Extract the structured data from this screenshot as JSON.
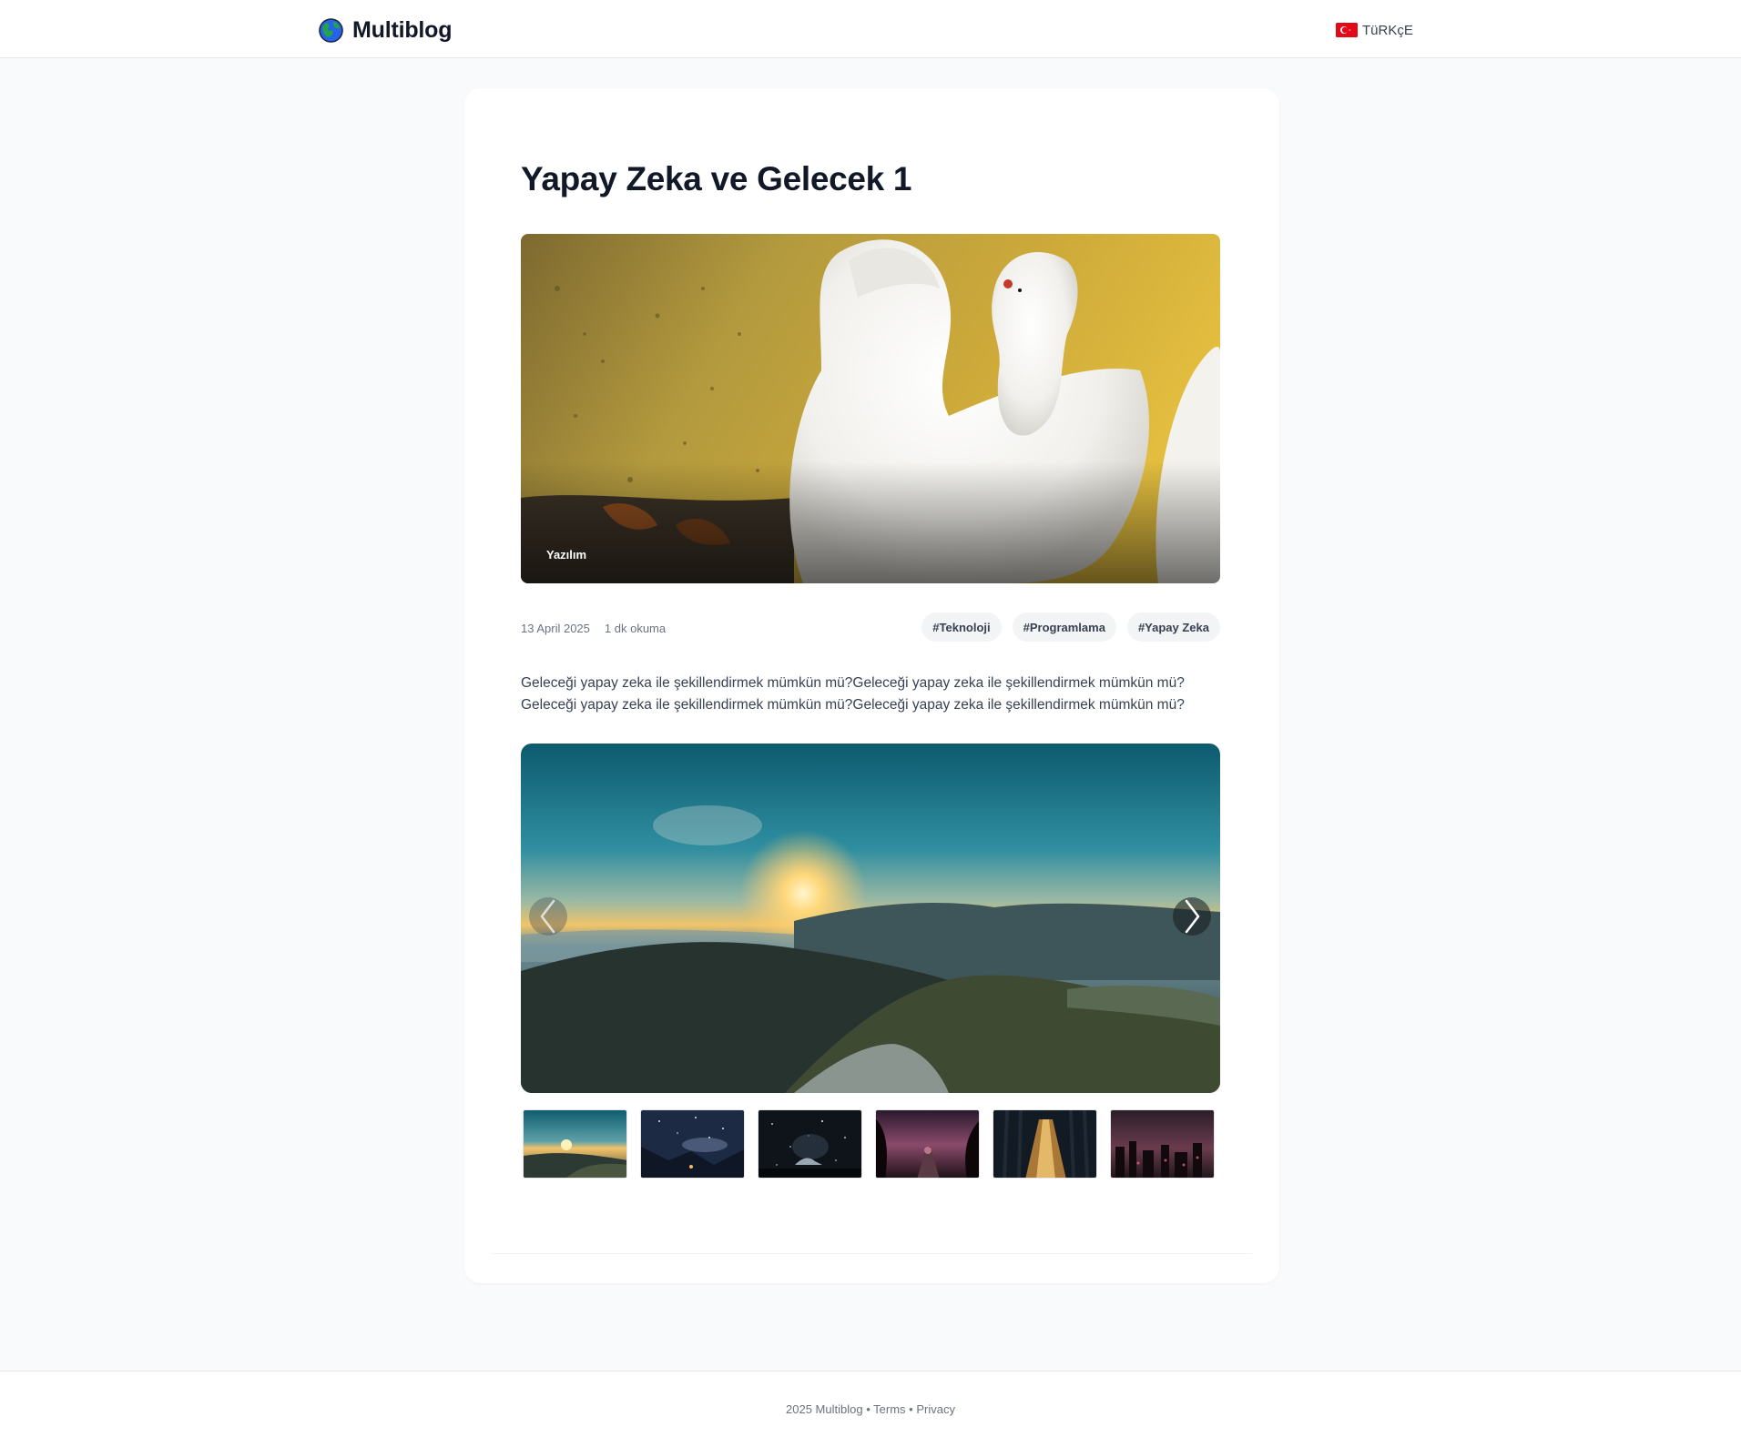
{
  "header": {
    "brand": "Multiblog",
    "brand_icon": "globe-icon",
    "language": "TüRKçE",
    "language_icon": "turkey-flag-icon"
  },
  "article": {
    "title": "Yapay Zeka ve Gelecek 1",
    "category": "Yazılım",
    "date": "13 April 2025",
    "read_time": "1 dk okuma",
    "tags": [
      "#Teknoloji",
      "#Programlama",
      "#Yapay Zeka"
    ],
    "body_lines": [
      "Geleceği yapay zeka ile şekillendirmek mümkün mü?Geleceği yapay zeka ile şekillendirmek mümkün mü?",
      "Geleceği yapay zeka ile şekillendirmek mümkün mü?Geleceği yapay zeka ile şekillendirmek mümkün mü?"
    ]
  },
  "gallery": {
    "prev_icon": "chevron-left-icon",
    "next_icon": "chevron-right-icon",
    "thumbnail_count": 6
  },
  "footer": {
    "copyright": "2025 Multiblog",
    "separator": "•",
    "terms": "Terms",
    "privacy": "Privacy"
  },
  "colors": {
    "page_bg": "#f9fafb",
    "card_bg": "#ffffff",
    "text": "#111827",
    "muted": "#6b7280",
    "tag_bg": "#f3f4f6"
  }
}
